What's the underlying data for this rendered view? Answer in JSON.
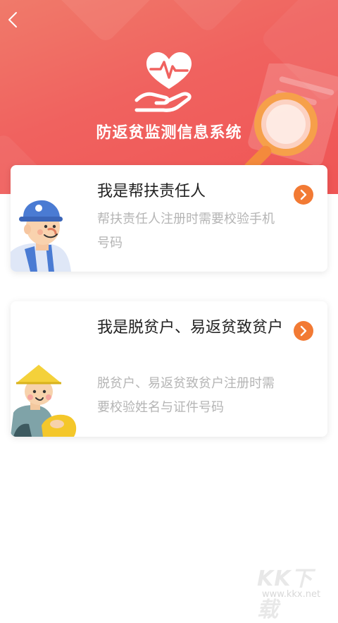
{
  "header": {
    "title": "防返贫监测信息系统"
  },
  "cards": [
    {
      "title": "我是帮扶责任人",
      "description": "帮扶责任人注册时需要校验手机号码"
    },
    {
      "title": "我是脱贫户、易返贫致贫户",
      "description": "脱贫户、易返贫致贫户注册时需要校验姓名与证件号码"
    }
  ],
  "watermark": {
    "logo": "KK下载",
    "url": "www.kkx.net"
  },
  "icons": {
    "back": "chevron-left-icon",
    "logo": "heart-hand-icon",
    "arrow": "chevron-right-circle-icon"
  },
  "colors": {
    "header_start": "#f07a6a",
    "header_end": "#ef5555",
    "arrow_orange": "#f27a34",
    "title_text": "#222222",
    "desc_text": "#b5b5b5"
  }
}
